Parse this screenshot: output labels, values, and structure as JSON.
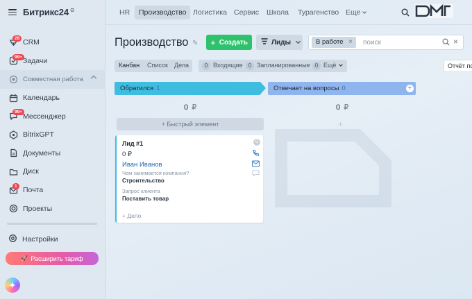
{
  "sidebar": {
    "brand": "Битрикс24",
    "items": [
      {
        "label": "CRM",
        "icon": "crm-icon",
        "badge": "28"
      },
      {
        "label": "Задачи",
        "icon": "tasks-icon",
        "badge": "99+"
      },
      {
        "label": "Совместная работа",
        "icon": "collab-icon",
        "section": true
      },
      {
        "label": "Календарь",
        "icon": "calendar-icon"
      },
      {
        "label": "Мессенджер",
        "icon": "messenger-icon",
        "badge": "99+"
      },
      {
        "label": "BitrixGPT",
        "icon": "gpt-icon"
      },
      {
        "label": "Документы",
        "icon": "documents-icon"
      },
      {
        "label": "Диск",
        "icon": "disk-icon"
      },
      {
        "label": "Почта",
        "icon": "mail-icon",
        "badge": "1"
      },
      {
        "label": "Проекты",
        "icon": "projects-icon"
      }
    ],
    "settings": "Настройки",
    "upgrade": "Расширить тариф"
  },
  "topnav": {
    "items": [
      "HR",
      "Производство",
      "Логистика",
      "Сервис",
      "Школа",
      "Турагенство",
      "Еще"
    ],
    "active": "Производство"
  },
  "header": {
    "title": "Производство",
    "create": "Создать",
    "entity": "Лиды",
    "filter_chip": "В работе",
    "search_placeholder": "поиск"
  },
  "viewbar": {
    "tabs": [
      "Канбан",
      "Список",
      "Дела"
    ],
    "counters": [
      {
        "n": "0",
        "label": "Входящие"
      },
      {
        "n": "0",
        "label": "Запланированные"
      },
      {
        "n": "0",
        "label": "Ещё"
      }
    ],
    "report": "Отчёт по"
  },
  "columns": [
    {
      "title": "Обратился",
      "count": "1",
      "sum": "0",
      "currency": "₽",
      "color": "#3fbde0"
    },
    {
      "title": "Отвечает на вопросы",
      "count": "0",
      "sum": "0",
      "currency": "₽",
      "color": "#8fb5ee"
    }
  ],
  "quick_add": "Быстрый элемент",
  "card": {
    "title": "Лид #1",
    "price": "0 ₽",
    "contact": "Иван Иванов",
    "q1": "Чем занимается компания?",
    "a1": "Строительство",
    "q2": "Запрос клиента",
    "a2": "Поставить товар",
    "deal": "+ Дело",
    "badge": "0"
  }
}
